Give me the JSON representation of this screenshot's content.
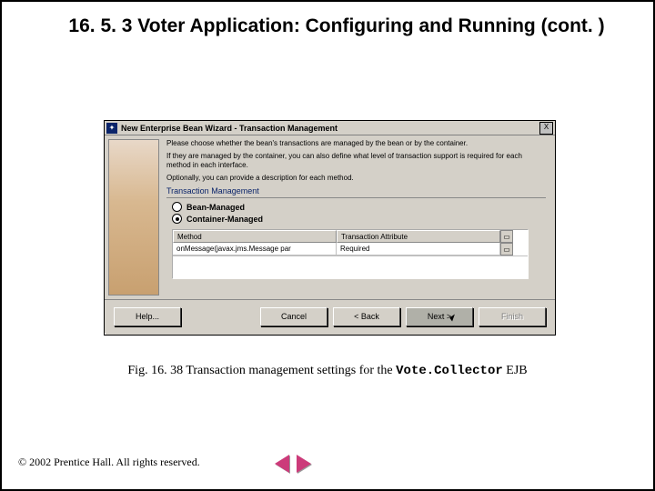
{
  "heading": "16. 5. 3   Voter Application: Configuring and Running (cont. )",
  "wizard": {
    "title": "New Enterprise Bean Wizard - Transaction Management",
    "close_glyph": "X",
    "instructions": {
      "line1": "Please choose whether the bean's transactions are managed by the bean or by the container.",
      "line2": "If they are managed by the container, you can also define what level of transaction support is required for each method in each interface.",
      "line3": "Optionally, you can provide a description for each method."
    },
    "group_label": "Transaction Management",
    "radios": {
      "bean": "Bean-Managed",
      "container": "Container-Managed"
    },
    "grid": {
      "headers": {
        "method": "Method",
        "attr": "Transaction Attribute"
      },
      "row": {
        "method": "onMessage(javax.jms.Message par",
        "attr": "Required"
      },
      "doc_glyph": "▭"
    },
    "buttons": {
      "help": "Help...",
      "cancel": "Cancel",
      "back": "< Back",
      "next": "Next >",
      "finish": "Finish"
    }
  },
  "caption": {
    "prefix": "Fig. 16. 38 Transaction management settings for the ",
    "code": "Vote.Collector",
    "suffix": " EJB"
  },
  "footer": "© 2002 Prentice Hall. All rights reserved."
}
